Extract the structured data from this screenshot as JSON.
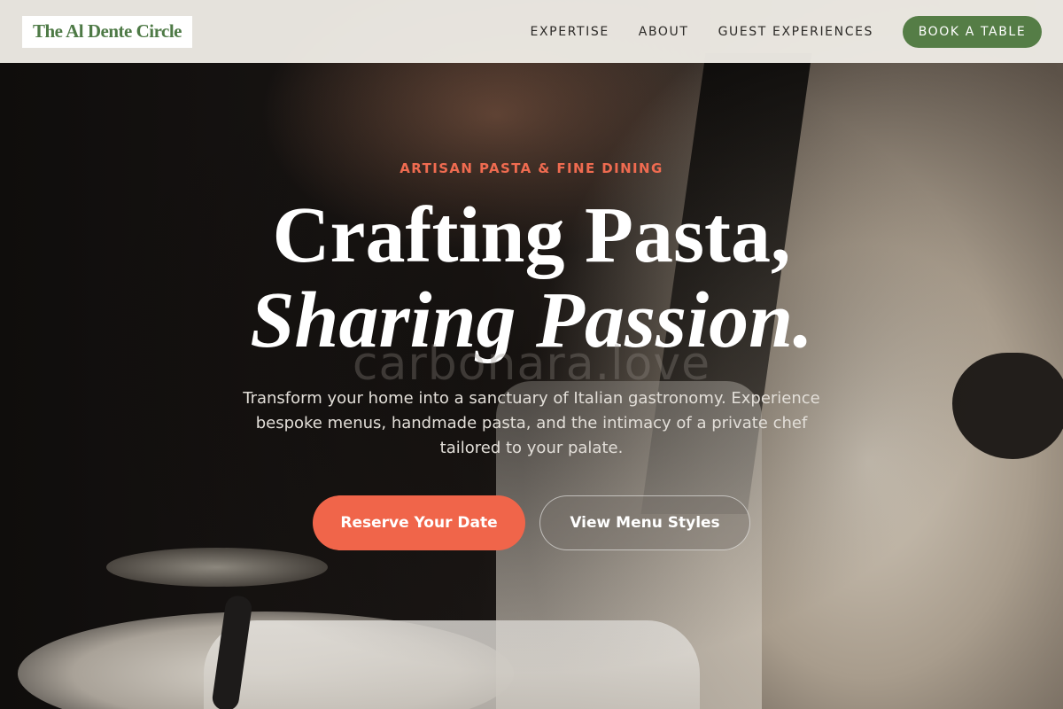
{
  "brand": {
    "logo_text": "The Al Dente Circle"
  },
  "nav": {
    "links": [
      {
        "label": "EXPERTISE"
      },
      {
        "label": "ABOUT"
      },
      {
        "label": "GUEST EXPERIENCES"
      }
    ],
    "cta_label": "BOOK A TABLE"
  },
  "hero": {
    "eyebrow": "ARTISAN PASTA & FINE DINING",
    "headline_line1": "Crafting Pasta,",
    "headline_line2": "Sharing Passion.",
    "watermark": "carbonara.love",
    "description": "Transform your home into a sanctuary of Italian gastronomy. Experience bespoke menus, handmade pasta, and the intimacy of a private chef tailored to your palate.",
    "primary_cta": "Reserve Your Date",
    "secondary_cta": "View Menu Styles"
  },
  "colors": {
    "brand_green": "#557d46",
    "accent_coral": "#f0654a",
    "navbar_bg": "#eeebe5"
  }
}
